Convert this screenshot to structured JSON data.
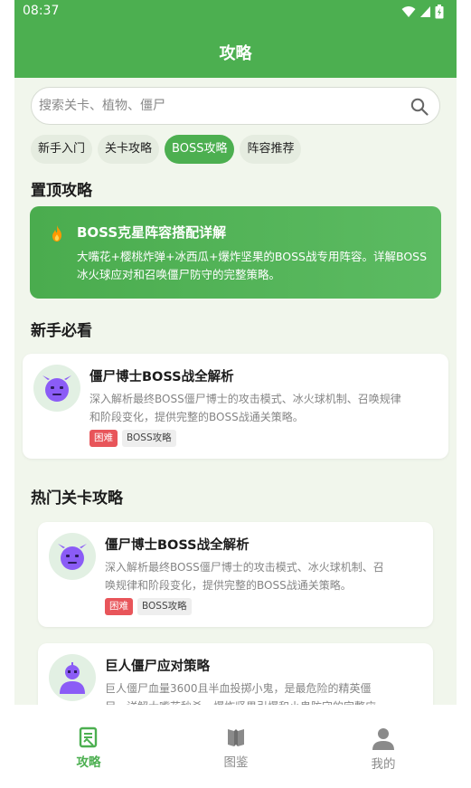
{
  "status_bar": {
    "time": "08:37"
  },
  "app_bar": {
    "title": "攻略"
  },
  "search": {
    "placeholder": "搜索关卡、植物、僵尸"
  },
  "chips": [
    {
      "label": "新手入门",
      "active": false
    },
    {
      "label": "关卡攻略",
      "active": false
    },
    {
      "label": "BOSS攻略",
      "active": true
    },
    {
      "label": "阵容推荐",
      "active": false
    }
  ],
  "pinned": {
    "section_title": "置顶攻略",
    "title": "BOSS克星阵容搭配详解",
    "desc": "大嘴花+樱桃炸弹+冰西瓜+爆炸坚果的BOSS战专用阵容。详解BOSS冰火球应对和召唤僵尸防守的完整策略。",
    "icon": "fire-icon"
  },
  "beginner": {
    "section_title": "新手必看",
    "items": [
      {
        "title": "僵尸博士BOSS战全解析",
        "desc_lines": [
          "深入解析最终BOSS僵尸博士的攻击模式、冰火球机制、召唤规律",
          "和阶段变化，提供完整的BOSS战通关策略。"
        ],
        "tags": [
          "困难",
          "BOSS攻略"
        ],
        "icon": "zombie-boss-icon"
      }
    ]
  },
  "hot": {
    "section_title": "热门关卡攻略",
    "items": [
      {
        "title": "僵尸博士BOSS战全解析",
        "desc_lines": [
          "深入解析最终BOSS僵尸博士的攻击模式、冰火球机制、召",
          "唤规律和阶段变化，提供完整的BOSS战通关策略。"
        ],
        "tags": [
          "困难",
          "BOSS攻略"
        ],
        "icon": "zombie-boss-icon"
      },
      {
        "title": "巨人僵尸应对策略",
        "desc_lines": [
          "巨人僵尸血量3600且半血投掷小鬼，是最危险的精英僵",
          "尸。详解大嘴花秒杀、爆炸坚果引爆和小鬼防守的完整应"
        ],
        "icon": "giant-zombie-icon"
      }
    ]
  },
  "bottom_nav": [
    {
      "label": "攻略",
      "icon": "guide-icon",
      "active": true
    },
    {
      "label": "图鉴",
      "icon": "book-icon",
      "active": false
    },
    {
      "label": "我的",
      "icon": "user-icon",
      "active": false
    }
  ],
  "colors": {
    "primary": "#4caf50",
    "background": "#f1f6ec",
    "danger_tag": "#e8555a",
    "boss_avatar": "#8b5cf6",
    "fire": "#ff9800"
  }
}
